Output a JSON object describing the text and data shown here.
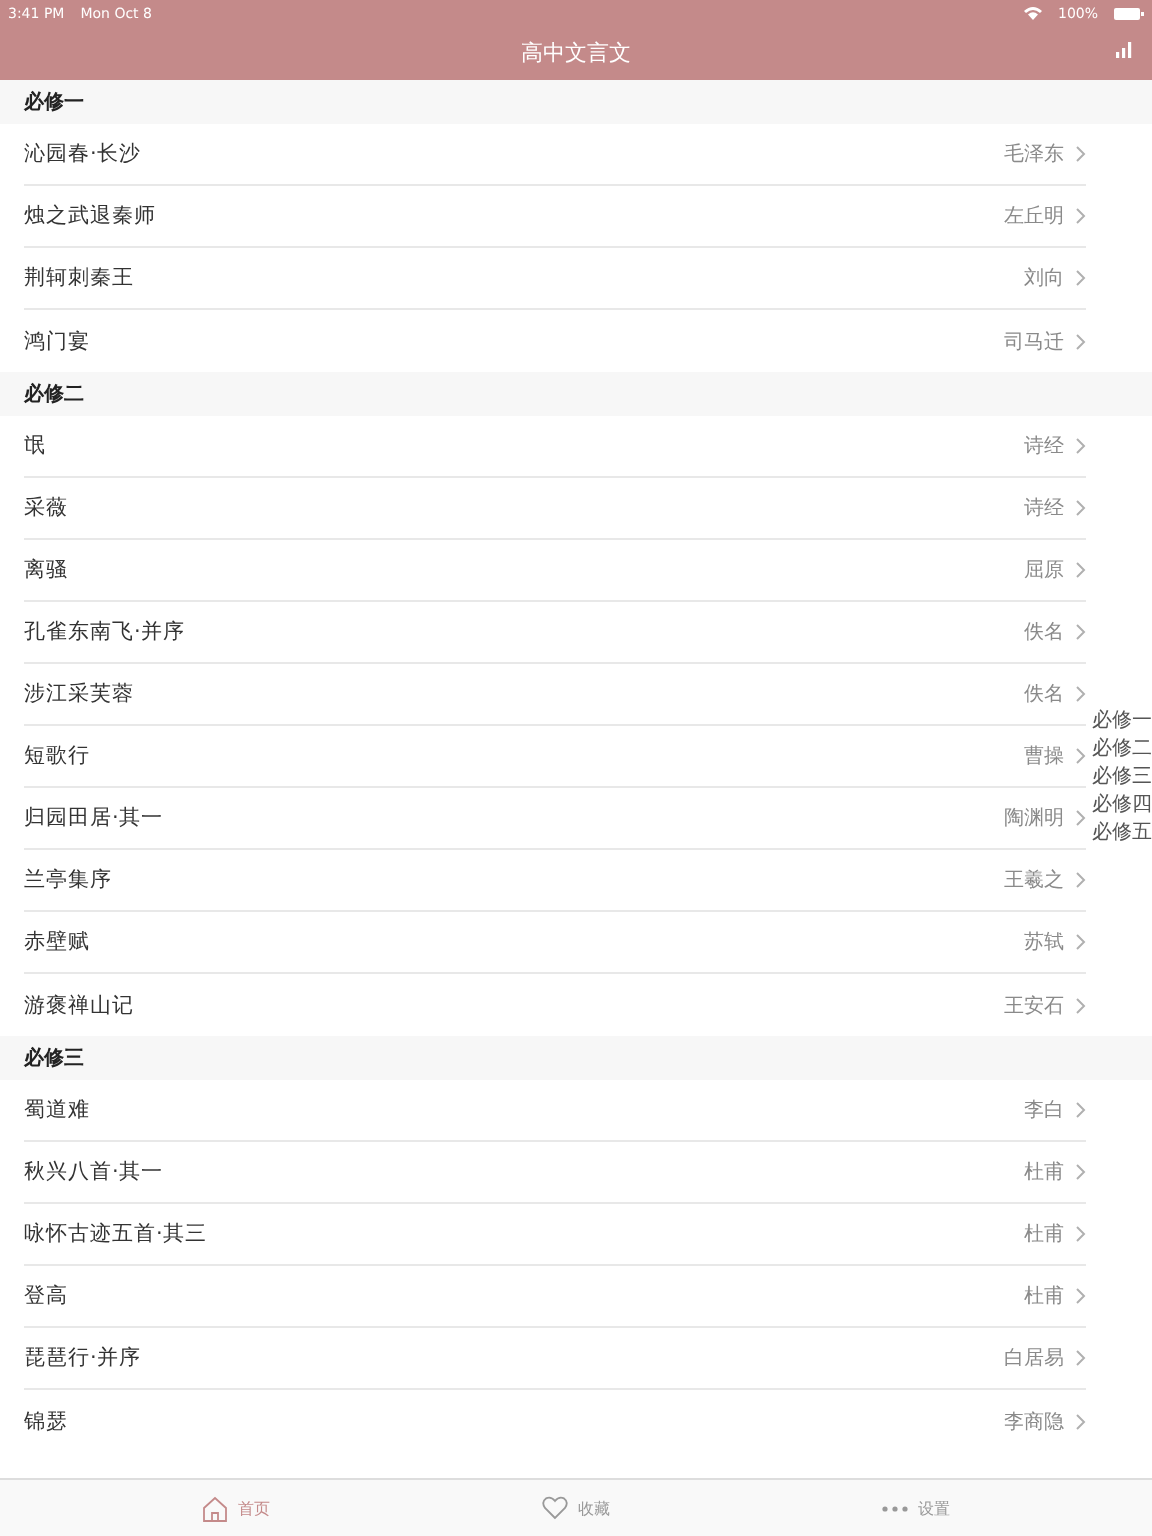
{
  "status_bar": {
    "time": "3:41 PM",
    "date": "Mon Oct 8",
    "battery": "100%"
  },
  "nav_bar": {
    "title": "高中文言文"
  },
  "sections": [
    {
      "title": "必修一",
      "rows": [
        {
          "title": "沁园春·长沙",
          "author": "毛泽东"
        },
        {
          "title": "烛之武退秦师",
          "author": "左丘明"
        },
        {
          "title": "荆轲刺秦王",
          "author": "刘向"
        },
        {
          "title": "鸿门宴",
          "author": "司马迁"
        }
      ]
    },
    {
      "title": "必修二",
      "rows": [
        {
          "title": "氓",
          "author": "诗经"
        },
        {
          "title": "采薇",
          "author": "诗经"
        },
        {
          "title": "离骚",
          "author": "屈原"
        },
        {
          "title": "孔雀东南飞·并序",
          "author": "佚名"
        },
        {
          "title": "涉江采芙蓉",
          "author": "佚名"
        },
        {
          "title": "短歌行",
          "author": "曹操"
        },
        {
          "title": "归园田居·其一",
          "author": "陶渊明"
        },
        {
          "title": "兰亭集序",
          "author": "王羲之"
        },
        {
          "title": "赤壁赋",
          "author": "苏轼"
        },
        {
          "title": "游褒禅山记",
          "author": "王安石"
        }
      ]
    },
    {
      "title": "必修三",
      "rows": [
        {
          "title": "蜀道难",
          "author": "李白"
        },
        {
          "title": "秋兴八首·其一",
          "author": "杜甫"
        },
        {
          "title": "咏怀古迹五首·其三",
          "author": "杜甫"
        },
        {
          "title": "登高",
          "author": "杜甫"
        },
        {
          "title": "琵琶行·并序",
          "author": "白居易"
        },
        {
          "title": "锦瑟",
          "author": "李商隐"
        }
      ]
    }
  ],
  "section_index": [
    "必修一",
    "必修二",
    "必修三",
    "必修四",
    "必修五"
  ],
  "tab_bar": [
    {
      "kind": "home",
      "label": "首页",
      "selected": true
    },
    {
      "kind": "heart",
      "label": "收藏",
      "selected": false
    },
    {
      "kind": "more",
      "label": "设置",
      "selected": false
    }
  ]
}
